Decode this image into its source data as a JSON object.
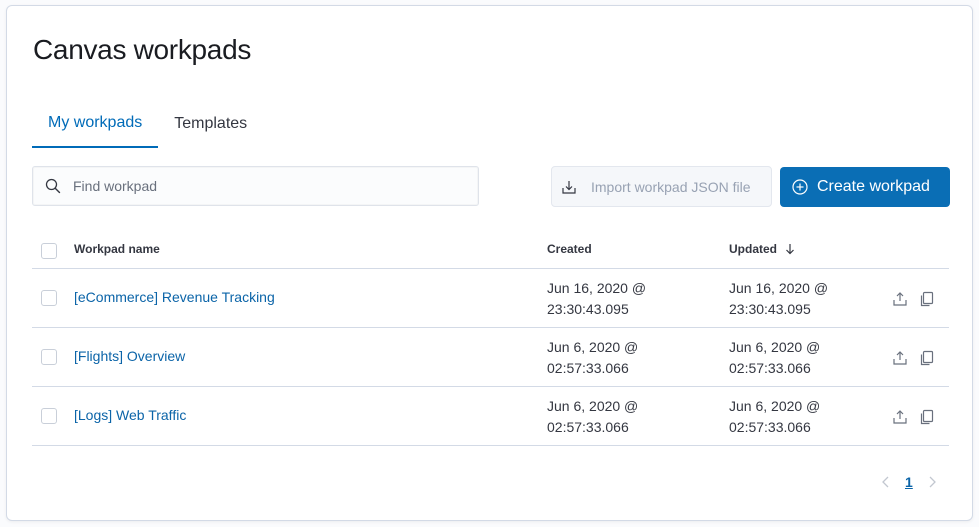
{
  "page": {
    "title": "Canvas workpads"
  },
  "tabs": [
    {
      "label": "My workpads",
      "active": true
    },
    {
      "label": "Templates",
      "active": false
    }
  ],
  "toolbar": {
    "search_placeholder": "Find workpad",
    "search_value": "",
    "import_label": "Import workpad JSON file",
    "create_label": "Create workpad"
  },
  "table": {
    "columns": {
      "name": "Workpad name",
      "created": "Created",
      "updated": "Updated"
    },
    "sort": {
      "column": "Updated",
      "direction": "descending"
    },
    "rows": [
      {
        "name": "[eCommerce] Revenue Tracking",
        "created_date": "Jun 16, 2020 @",
        "created_time": "23:30:43.095",
        "updated_date": "Jun 16, 2020 @",
        "updated_time": "23:30:43.095"
      },
      {
        "name": "[Flights] Overview",
        "created_date": "Jun 6, 2020 @",
        "created_time": "02:57:33.066",
        "updated_date": "Jun 6, 2020 @",
        "updated_time": "02:57:33.066"
      },
      {
        "name": "[Logs] Web Traffic",
        "created_date": "Jun 6, 2020 @",
        "created_time": "02:57:33.066",
        "updated_date": "Jun 6, 2020 @",
        "updated_time": "02:57:33.066"
      }
    ]
  },
  "pagination": {
    "current_page": "1"
  },
  "colors": {
    "accent": "#006bb8",
    "primary_button": "#0a6eb5",
    "link": "#0b64a8",
    "border": "#d3dae6"
  },
  "icons": [
    "search-icon",
    "import-icon",
    "plus-circle-icon",
    "sort-down-arrow-icon",
    "export-icon",
    "copy-icon",
    "chevron-left-icon",
    "chevron-right-icon"
  ]
}
